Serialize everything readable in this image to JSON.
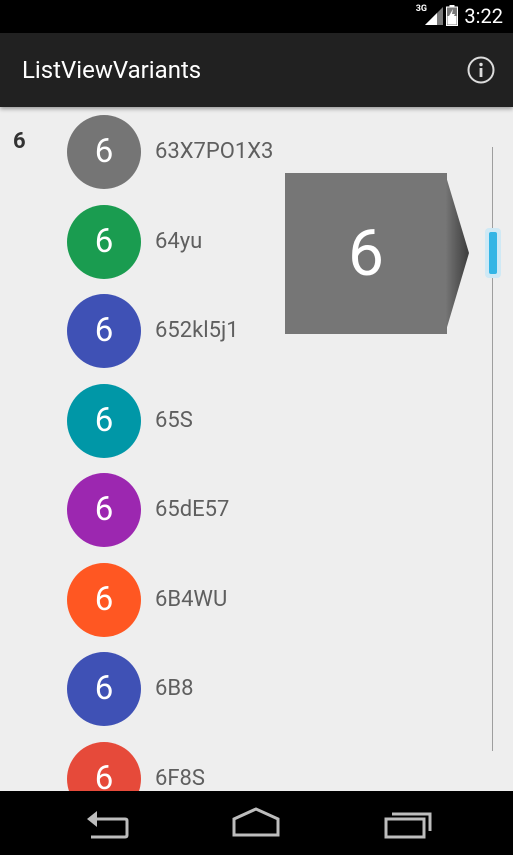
{
  "status_bar": {
    "time": "3:22",
    "network_type": "3G",
    "icons": [
      "signal-icon",
      "battery-icon"
    ]
  },
  "app_bar": {
    "title": "ListViewVariants",
    "action_icon": "info-icon"
  },
  "section_header": "6",
  "fast_scroll": {
    "preview_letter": "6"
  },
  "list": {
    "items": [
      {
        "letter": "6",
        "label": "63X7PO1X3",
        "color": "#757575"
      },
      {
        "letter": "6",
        "label": "64yu",
        "color": "#1a9c50"
      },
      {
        "letter": "6",
        "label": "652kl5j1",
        "color": "#3f51b5"
      },
      {
        "letter": "6",
        "label": "65S",
        "color": "#0097a7"
      },
      {
        "letter": "6",
        "label": "65dE57",
        "color": "#9c27b0"
      },
      {
        "letter": "6",
        "label": "6B4WU",
        "color": "#ff5722"
      },
      {
        "letter": "6",
        "label": "6B8",
        "color": "#3f51b5"
      },
      {
        "letter": "6",
        "label": "6F8S",
        "color": "#e64a3a"
      }
    ]
  },
  "nav_bar": {
    "icons": [
      "back-icon",
      "home-icon",
      "recents-icon"
    ]
  }
}
